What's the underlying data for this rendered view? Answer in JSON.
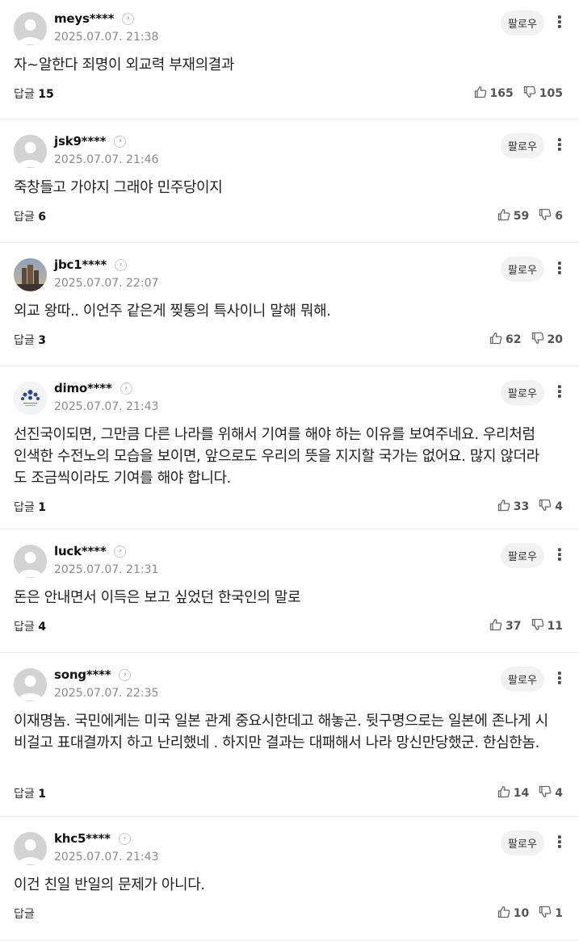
{
  "ui": {
    "follow_label": "팔로우",
    "reply_label": "답글",
    "arrow_glyph": "›",
    "more_glyph": "⋮"
  },
  "comments": [
    {
      "nickname": "meys****",
      "date": "2025.07.07. 21:38",
      "text": "자~알한다 죄명이 외교력 부재의결과",
      "reply_count": "15",
      "likes": "165",
      "dislikes": "105",
      "avatar": "default-avatar"
    },
    {
      "nickname": "jsk9****",
      "date": "2025.07.07. 21:46",
      "text": "죽창들고 가야지 그래야 민주당이지",
      "reply_count": "6",
      "likes": "59",
      "dislikes": "6",
      "avatar": "default-avatar"
    },
    {
      "nickname": "jbc1****",
      "date": "2025.07.07. 22:07",
      "text": "외교 왕따.. 이언주 같은게 찢통의 특사이니 말해 뭐해.",
      "reply_count": "3",
      "likes": "62",
      "dislikes": "20",
      "avatar": "photo-avatar"
    },
    {
      "nickname": "dimo****",
      "date": "2025.07.07. 21:43",
      "text": "선진국이되면, 그만큼 다른 나라를 위해서 기여를 해야 하는 이유를 보여주네요. 우리처럼 인색한 수전노의 모습을 보이면, 앞으로도 우리의 뜻을 지지할 국가는 없어요. 많지 않더라도 조금씩이라도 기여를 해야 합니다.",
      "reply_count": "1",
      "likes": "33",
      "dislikes": "4",
      "avatar": "emblem-avatar"
    },
    {
      "nickname": "luck****",
      "date": "2025.07.07. 21:31",
      "text": "돈은 안내면서 이득은 보고 싶었던 한국인의 말로",
      "reply_count": "4",
      "likes": "37",
      "dislikes": "11",
      "avatar": "default-avatar"
    },
    {
      "nickname": "song****",
      "date": "2025.07.07. 22:35",
      "text": "이재명놈. 국민에게는 미국 일본 관계 중요시한데고 해놓곤. 뒷구명으로는 일본에 존나게 시비걸고 표대결까지 하고 난리했네 . 하지만 결과는 대패해서 나라 망신만당했군. 한심한놈.",
      "reply_count": "1",
      "likes": "14",
      "dislikes": "4",
      "avatar": "default-avatar"
    },
    {
      "nickname": "khc5****",
      "date": "2025.07.07. 21:43",
      "text": "이건 친일 반일의 문제가 아니다.",
      "reply_count": "",
      "likes": "10",
      "dislikes": "1",
      "avatar": "default-avatar"
    }
  ]
}
